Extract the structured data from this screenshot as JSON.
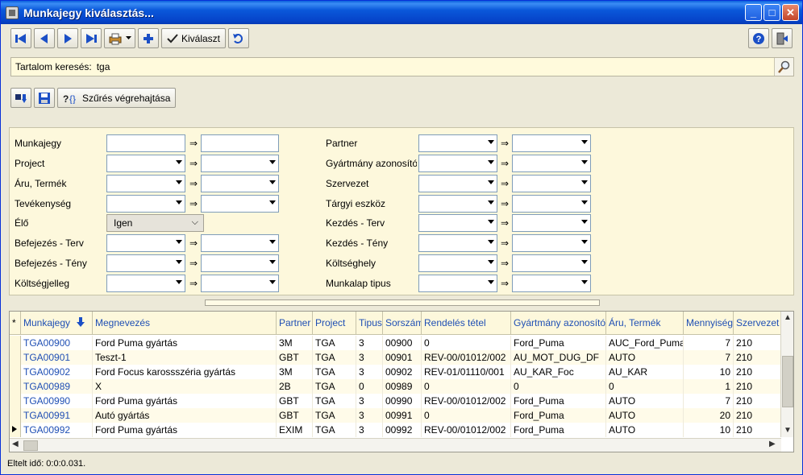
{
  "window": {
    "title": "Munkajegy kiválasztás..."
  },
  "toolbar": {
    "select_label": "Kiválaszt"
  },
  "search": {
    "label": "Tartalom keresés:",
    "value": "tga"
  },
  "filter_toolbar": {
    "run_label": "Szűrés végrehajtása"
  },
  "arrow_symbol": "⇒",
  "filters": {
    "left": [
      {
        "label": "Munkajegy"
      },
      {
        "label": "Project"
      },
      {
        "label": "Áru, Termék"
      },
      {
        "label": "Tevékenység"
      },
      {
        "label": "Élő",
        "value": "Igen"
      },
      {
        "label": "Befejezés - Terv"
      },
      {
        "label": "Befejezés - Tény"
      },
      {
        "label": "Költségjelleg"
      }
    ],
    "right": [
      {
        "label": "Partner"
      },
      {
        "label": "Gyártmány azonosító"
      },
      {
        "label": "Szervezet"
      },
      {
        "label": "Tárgyi eszköz"
      },
      {
        "label": "Kezdés - Terv"
      },
      {
        "label": "Kezdés - Tény"
      },
      {
        "label": "Költséghely"
      },
      {
        "label": "Munkalap tipus"
      }
    ]
  },
  "grid": {
    "indicator_header": "*",
    "columns": [
      "Munkajegy",
      "Megnevezés",
      "Partner",
      "Project",
      "Tipus",
      "Sorszám",
      "Rendelés tétel",
      "Gyártmány azonosító",
      "Áru, Termék",
      "Mennyiség",
      "Szervezet"
    ],
    "rows": [
      [
        "TGA00900",
        "Ford Puma gyártás",
        "3M",
        "TGA",
        "3",
        "00900",
        "0",
        "Ford_Puma",
        "AUC_Ford_Puma",
        "7",
        "210"
      ],
      [
        "TGA00901",
        "Teszt-1",
        "GBT",
        "TGA",
        "3",
        "00901",
        "REV-00/01012/002",
        "AU_MOT_DUG_DF",
        "AUTO",
        "7",
        "210"
      ],
      [
        "TGA00902",
        "Ford Focus karossszéria gyártás",
        "3M",
        "TGA",
        "3",
        "00902",
        "REV-01/01110/001",
        "AU_KAR_Foc",
        "AU_KAR",
        "10",
        "210"
      ],
      [
        "TGA00989",
        "X",
        "2B",
        "TGA",
        "0",
        "00989",
        "0",
        "0",
        "0",
        "1",
        "210"
      ],
      [
        "TGA00990",
        "Ford Puma gyártás",
        "GBT",
        "TGA",
        "3",
        "00990",
        "REV-00/01012/002",
        "Ford_Puma",
        "AUTO",
        "7",
        "210"
      ],
      [
        "TGA00991",
        "Autó gyártás",
        "GBT",
        "TGA",
        "3",
        "00991",
        "0",
        "Ford_Puma",
        "AUTO",
        "20",
        "210"
      ],
      [
        "TGA00992",
        "Ford Puma gyártás",
        "EXIM",
        "TGA",
        "3",
        "00992",
        "REV-00/01012/002",
        "Ford_Puma",
        "AUTO",
        "10",
        "210"
      ]
    ],
    "current_row_index": 6
  },
  "status": {
    "text": "Eltelt idő: 0:0:0.031."
  }
}
